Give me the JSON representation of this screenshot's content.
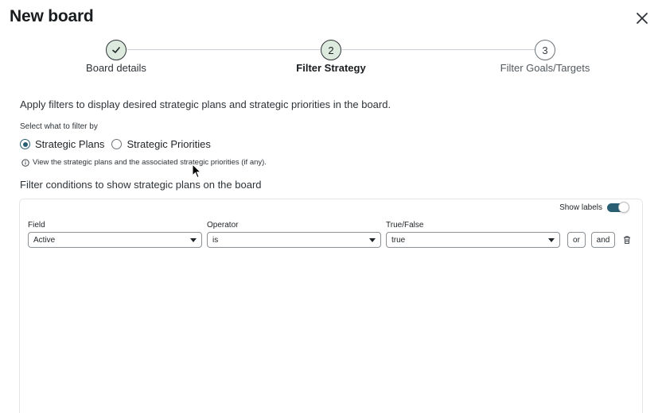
{
  "header": {
    "title": "New board",
    "close_icon": "close-icon"
  },
  "steps": [
    {
      "number": "1",
      "label": "Board details",
      "state": "done"
    },
    {
      "number": "2",
      "label": "Filter Strategy",
      "state": "active"
    },
    {
      "number": "3",
      "label": "Filter Goals/Targets",
      "state": "todo"
    }
  ],
  "intro": "Apply filters to display desired strategic plans and strategic priorities in the board.",
  "filter_by": {
    "label": "Select what to filter by",
    "options": [
      "Strategic Plans",
      "Strategic Priorities"
    ],
    "selected": "Strategic Plans"
  },
  "info_text": "View the strategic plans and the associated strategic priorities (if any).",
  "conditions": {
    "heading": "Filter conditions to show strategic plans on the board",
    "show_labels": "Show labels",
    "show_labels_on": true,
    "row": {
      "field_label": "Field",
      "field_value": "Active",
      "operator_label": "Operator",
      "operator_value": "is",
      "value_label": "True/False",
      "value_value": "true",
      "or_label": "or",
      "and_label": "and"
    }
  },
  "colors": {
    "accent": "#2a5f73",
    "step_fill": "#dcebdd"
  }
}
